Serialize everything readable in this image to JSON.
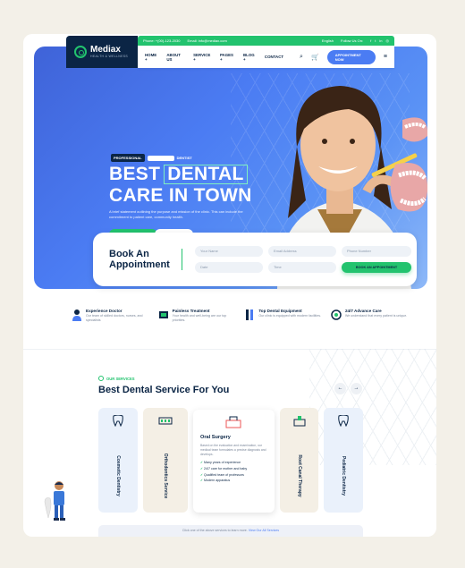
{
  "topbar": {
    "phone": "Phone: +(00)-123-2030",
    "email": "Email: info@mediax.com",
    "language": "English",
    "follow": "Follow Us On:"
  },
  "logo": {
    "name": "Mediax",
    "tagline": "HEALTH & WELLNESS"
  },
  "nav": {
    "items": [
      "HOME +",
      "ABOUT US",
      "SERVICE +",
      "PAGES +",
      "BLOG +",
      "CONTACT"
    ],
    "cart_count": "0",
    "appointment": "APPOINTMENT NOW"
  },
  "hero": {
    "badge_left": "PROFESSIONAL",
    "badge_right": "DENTIST",
    "line1_a": "BEST",
    "line1_b": "DENTAL",
    "line2": "CARE IN TOWN",
    "description": "A brief statement outlining the purpose and mission of the clinic. This can include the commitment to patient care, community health.",
    "btn_services": "SEE ALL SERVICES",
    "btn_contact": "CONTACT US"
  },
  "booking": {
    "title_line1": "Book An",
    "title_line2": "Appointment",
    "name_placeholder": "Your Name",
    "email_placeholder": "Email Address",
    "phone_placeholder": "Phone Number",
    "date_placeholder": "Date",
    "time_placeholder": "Time",
    "submit": "BOOK AN APPOINTMENT"
  },
  "features": [
    {
      "title": "Experience Doctor",
      "desc": "Our team of skilled doctors, nurses, and specialists"
    },
    {
      "title": "Painless Treatment",
      "desc": "Your health and well-being are our top priorities."
    },
    {
      "title": "Top Dental Equipment",
      "desc": "Our clinic is equipped with modern facilities."
    },
    {
      "title": "24/7 Advance Care",
      "desc": "We understand that every patient is unique."
    }
  ],
  "services": {
    "tag": "OUR SERVICES",
    "title": "Best Dental Service For You",
    "prev": "←",
    "next": "→",
    "cards": [
      "Cosmetic Dentistry",
      "Orthodontics Service",
      "Root Canal Therapy",
      "Pediatric Dentistry"
    ],
    "featured": {
      "title": "Oral Surgery",
      "desc": "Based on the evaluation and examination, our medical team formulates a precise diagnosis and develops.",
      "list": [
        "Many years of experience",
        "24/7 care for mother and baby",
        "Qualified team of professors",
        "Modern apparatus"
      ]
    },
    "footnote_text": "Click one of the above services to learn more.",
    "footnote_link": "View Our All Services"
  },
  "colors": {
    "primary": "#4b7cf3",
    "accent": "#22c36e",
    "dark": "#0b2545",
    "cream": "#f4efe5"
  }
}
